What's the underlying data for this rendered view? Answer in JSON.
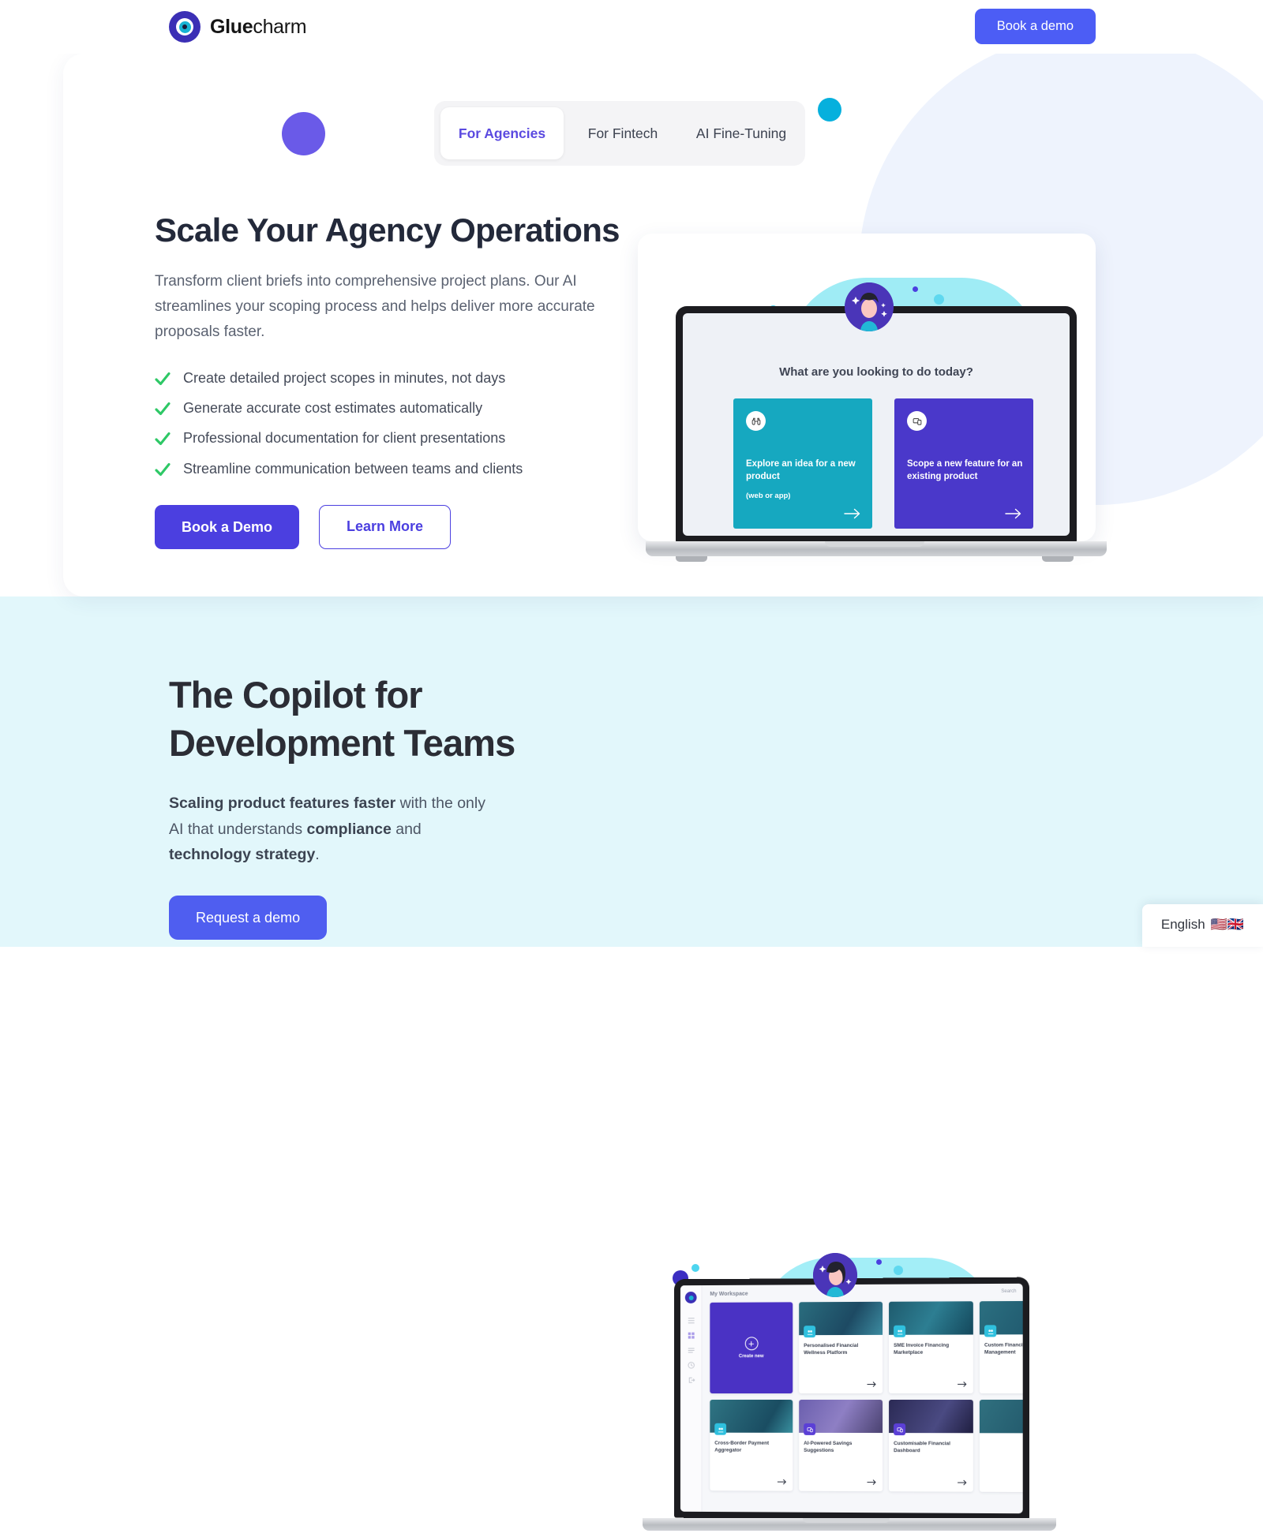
{
  "header": {
    "logo_bold": "Glue",
    "logo_light": "charm",
    "cta_label": "Book a demo"
  },
  "hero": {
    "tabs": [
      {
        "label": "For Agencies",
        "active": true
      },
      {
        "label": "For Fintech",
        "active": false
      },
      {
        "label": "AI Fine-Tuning",
        "active": false
      }
    ],
    "title": "Scale Your Agency Operations",
    "paragraph": "Transform client briefs into comprehensive project plans. Our AI streamlines your scoping process and helps deliver more accurate proposals faster.",
    "features": [
      "Create detailed project scopes in minutes, not days",
      "Generate accurate cost estimates automatically",
      "Professional documentation for client presentations",
      "Streamline communication between teams and clients"
    ],
    "primary_button": "Book a Demo",
    "secondary_button": "Learn More",
    "colors": {
      "accent_purple": "#4b3fe0",
      "header_blue": "#4c5df5",
      "check_green": "#2ec866",
      "cyan_dot": "#06b0dd",
      "purple_dot": "#6a5ae8"
    }
  },
  "mockup1": {
    "question": "What are you looking to do today?",
    "cards": [
      {
        "title": "Explore an idea for a new product",
        "subtitle": "(web or app)",
        "color": "#16a8c0",
        "icon": "binoculars-icon"
      },
      {
        "title": "Scope a new feature for an existing product",
        "subtitle": "",
        "color": "#4a38ca",
        "icon": "devices-icon"
      }
    ]
  },
  "section2": {
    "title_line1": "The Copilot for",
    "title_line2": "Development Teams",
    "paragraph": {
      "b1": "Scaling product features faster",
      "t1": " with the only AI that understands ",
      "b2": "compliance",
      "t2": " and ",
      "b3": "technology strategy",
      "t3": "."
    },
    "button_label": "Request a demo",
    "background": "#e2f7fb"
  },
  "mockup2": {
    "workspace_label": "My Workspace",
    "search_label": "Search",
    "create_label": "Create new",
    "tiles": [
      "Personalised Financial Wellness Platform",
      "SME Invoice Financing Marketplace",
      "Custom Financial Management",
      "Cross-Border Payment Aggregator",
      "AI-Powered Savings Suggestions",
      "Customisable Financial Dashboard"
    ]
  },
  "language_widget": {
    "label": "English",
    "flags": "🇺🇸🇬🇧"
  }
}
